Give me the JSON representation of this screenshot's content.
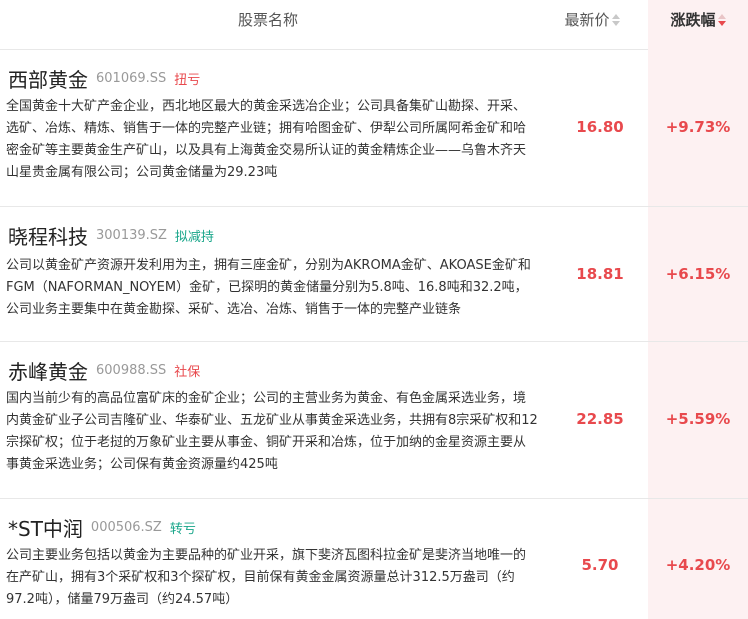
{
  "header": {
    "name_label": "股票名称",
    "price_label": "最新价",
    "change_label": "涨跌幅"
  },
  "rows": [
    {
      "name": "西部黄金",
      "code": "601069.SS",
      "tag": "扭亏",
      "tag_color": "#e8494d",
      "desc": "全国黄金十大矿产金企业，西北地区最大的黄金采选冶企业；公司具备集矿山勘探、开采、选矿、冶炼、精炼、销售于一体的完整产业链；拥有哈图金矿、伊犁公司所属阿希金矿和哈密金矿等主要黄金生产矿山，以及具有上海黄金交易所认证的黄金精炼企业——乌鲁木齐天山星贵金属有限公司；公司黄金储量为29.23吨",
      "price": "16.80",
      "change": "+9.73%"
    },
    {
      "name": "晓程科技",
      "code": "300139.SZ",
      "tag": "拟减持",
      "tag_color": "#17a589",
      "desc": "公司以黄金矿产资源开发利用为主，拥有三座金矿，分别为AKROMA金矿、AKOASE金矿和FGM（NAFORMAN_NOYEM）金矿，已探明的黄金储量分别为5.8吨、16.8吨和32.2吨，公司业务主要集中在黄金勘探、采矿、选冶、冶炼、销售于一体的完整产业链条",
      "price": "18.81",
      "change": "+6.15%"
    },
    {
      "name": "赤峰黄金",
      "code": "600988.SS",
      "tag": "社保",
      "tag_color": "#e8494d",
      "desc": "国内当前少有的高品位富矿床的金矿企业；公司的主营业务为黄金、有色金属采选业务，境内黄金矿业子公司吉隆矿业、华泰矿业、五龙矿业从事黄金采选业务，共拥有8宗采矿权和12宗探矿权；位于老挝的万象矿业主要从事金、铜矿开采和冶炼，位于加纳的金星资源主要从事黄金采选业务；公司保有黄金资源量约425吨",
      "price": "22.85",
      "change": "+5.59%"
    },
    {
      "name": "*ST中润",
      "code": "000506.SZ",
      "tag": "转亏",
      "tag_color": "#17a589",
      "desc": "公司主要业务包括以黄金为主要品种的矿业开采，旗下斐济瓦图科拉金矿是斐济当地唯一的在产矿山，拥有3个采矿权和3个探矿权，目前保有黄金金属资源量总计312.5万盎司（约97.2吨），储量79万盎司（约24.57吨）",
      "price": "5.70",
      "change": "+4.20%"
    }
  ]
}
